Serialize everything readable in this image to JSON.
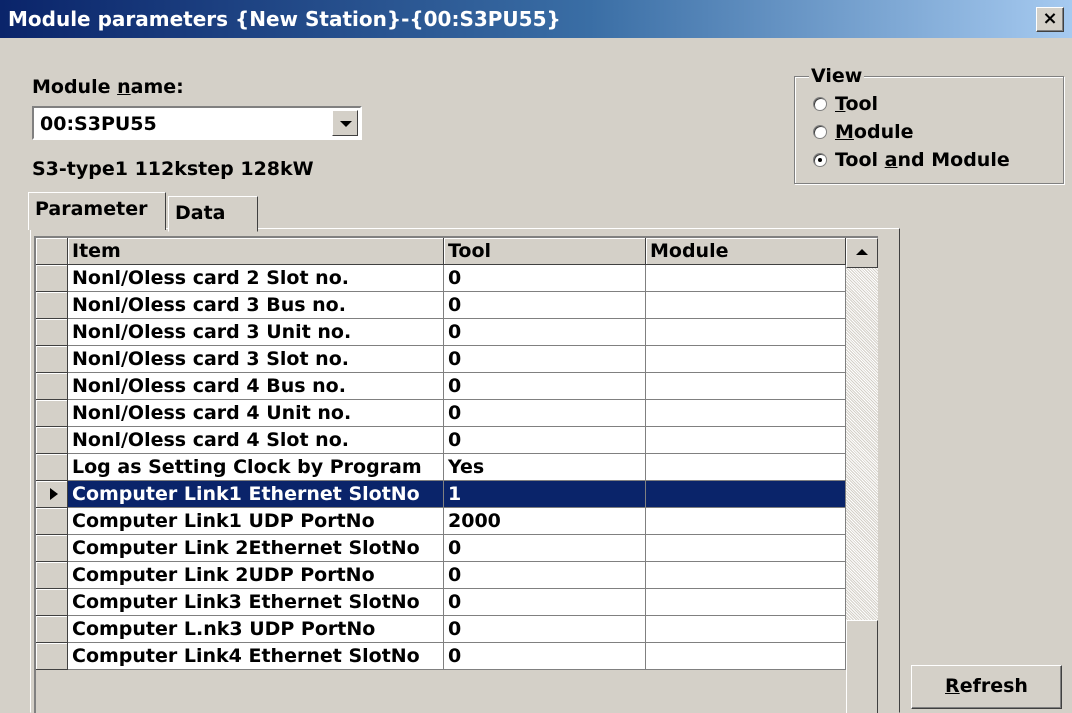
{
  "window": {
    "title": "Module parameters {New Station}-{00:S3PU55}",
    "close_label": "×"
  },
  "module": {
    "name_label_pre": "Module ",
    "name_label_u": "n",
    "name_label_post": "ame:",
    "selected": "00:S3PU55",
    "description": "S3-type1 112kstep 128kW"
  },
  "view": {
    "legend": "View",
    "options": [
      {
        "pre": "",
        "u": "T",
        "post": "ool",
        "selected": false
      },
      {
        "pre": "",
        "u": "M",
        "post": "odule",
        "selected": false
      },
      {
        "pre": "Tool ",
        "u": "a",
        "post": "nd Module",
        "selected": true
      }
    ]
  },
  "tabs": [
    {
      "label": "Parameter",
      "active": true
    },
    {
      "label": "Data",
      "active": false
    }
  ],
  "grid": {
    "columns": [
      "Item",
      "Tool",
      "Module"
    ],
    "rows": [
      {
        "item": "Nonl/Oless card 2 Slot no.",
        "tool": "0",
        "module": ""
      },
      {
        "item": "Nonl/Oless card 3 Bus no.",
        "tool": "0",
        "module": ""
      },
      {
        "item": "Nonl/Oless card 3 Unit no.",
        "tool": "0",
        "module": ""
      },
      {
        "item": "Nonl/Oless card 3 Slot no.",
        "tool": "0",
        "module": ""
      },
      {
        "item": "Nonl/Oless card 4 Bus no.",
        "tool": "0",
        "module": ""
      },
      {
        "item": "Nonl/Oless card 4 Unit no.",
        "tool": "0",
        "module": ""
      },
      {
        "item": "Nonl/Oless card 4 Slot no.",
        "tool": "0",
        "module": ""
      },
      {
        "item": "Log as Setting Clock by Program",
        "tool": "Yes",
        "module": ""
      },
      {
        "item": "Computer Link1 Ethernet SlotNo",
        "tool": "1",
        "module": "",
        "selected": true
      },
      {
        "item": "Computer Link1 UDP PortNo",
        "tool": "2000",
        "module": ""
      },
      {
        "item": "Computer Link 2Ethernet SlotNo",
        "tool": "0",
        "module": ""
      },
      {
        "item": "Computer Link 2UDP PortNo",
        "tool": "0",
        "module": ""
      },
      {
        "item": "Computer Link3 Ethernet SlotNo",
        "tool": "0",
        "module": ""
      },
      {
        "item": "Computer L.nk3 UDP PortNo",
        "tool": "0",
        "module": ""
      },
      {
        "item": "Computer Link4 Ethernet SlotNo",
        "tool": "0",
        "module": ""
      }
    ]
  },
  "buttons": {
    "refresh_u": "R",
    "refresh_post": "efresh"
  }
}
